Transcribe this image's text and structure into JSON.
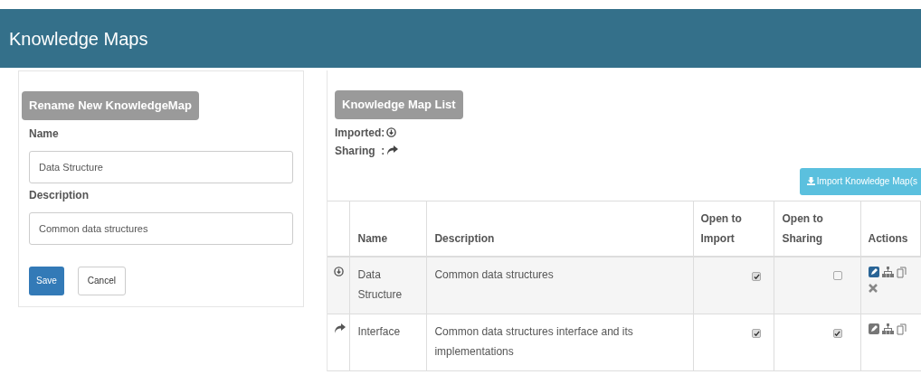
{
  "header": {
    "title": "Knowledge Maps"
  },
  "rename_panel": {
    "heading": "Rename New KnowledgeMap",
    "name_label": "Name",
    "name_value": "Data Structure",
    "description_label": "Description",
    "description_value": "Common data structures",
    "buttons": [
      {
        "label": "Save",
        "kind": "primary"
      },
      {
        "label": "Cancel",
        "kind": "default"
      }
    ]
  },
  "list_panel": {
    "heading": "Knowledge Map List",
    "legend": [
      {
        "label": "Imported:",
        "kind": "imported"
      },
      {
        "label": "Sharing  :",
        "kind": "shared"
      }
    ],
    "import_button": "Import Knowledge Map(s",
    "table": {
      "columns": [
        "Name",
        "Description",
        "Open to Import",
        "Open to Sharing",
        "Actions"
      ],
      "rows": [
        {
          "kind": "imported",
          "name": "Data Structure",
          "description": "Common data structures",
          "open_to_import": true,
          "open_to_sharing": false,
          "selected": true,
          "deletable": true
        },
        {
          "kind": "shared",
          "name": "Interface",
          "description": "Common data structures interface and its implementations",
          "open_to_import": true,
          "open_to_sharing": true,
          "selected": false,
          "deletable": false
        }
      ]
    }
  }
}
